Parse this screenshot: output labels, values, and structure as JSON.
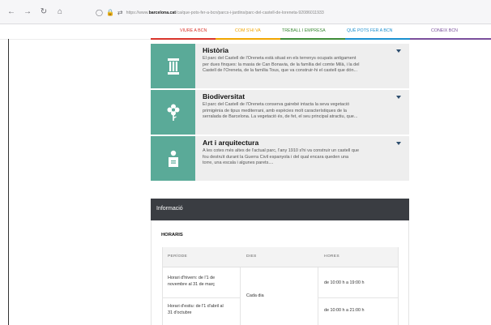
{
  "browser": {
    "url_prefix": "https://www.",
    "url_domain": "barcelona.cat",
    "url_path": "/ca/que-pots-fer-a-bcn/parcs-i-jardins/parc-del-castell-de-loreneta-92086011933"
  },
  "site_nav": {
    "items": [
      {
        "label": "VIURE A BCN",
        "color": "#d9342b"
      },
      {
        "label": "COM S'HI VA",
        "color": "#f0a500"
      },
      {
        "label": "TREBALL I EMPRESA",
        "color": "#3d8b37"
      },
      {
        "label": "QUÈ POTS FER A BCN",
        "color": "#1a8fcf"
      },
      {
        "label": "CONEIX BCN",
        "color": "#7a4f9c"
      }
    ]
  },
  "cards": [
    {
      "icon": "column-icon",
      "title": "Història",
      "lines": [
        "El parc del Castell de l'Oreneta està situat en els terrenys ocupats antigament",
        "per dues finques: la masia de Can Bonavia, de la família del comte Milà, i la del",
        "Castell de l'Oreneta, de la família Tous, que va construir-hi el castell que dón..."
      ]
    },
    {
      "icon": "flower-icon",
      "title": "Biodiversitat",
      "lines": [
        "El parc del Castell de l'Oreneta conserva gairebé intacta la seva vegetació",
        "primigènia de tipus mediterrani, amb espècies molt característiques de la",
        "serralada de Barcelona. La vegetació és, de fet, el seu principal atractiu, que..."
      ]
    },
    {
      "icon": "person-icon",
      "title": "Art i arquitectura",
      "lines": [
        "A les cotes més altes de l'actual parc, l'any 1910 s'hi va construir un castell que",
        "fou destruït durant la Guerra Civil espanyola i del qual encara queden una",
        "torre, una escala i algunes parets...."
      ]
    }
  ],
  "info": {
    "header": "Informació",
    "horaris_title": "HORARIS",
    "table": {
      "headers": [
        "PERÍODE",
        "DIES",
        "HORES"
      ],
      "rows": [
        {
          "periode": [
            "Horari d'hivern: de l'1 de",
            "novembre al 31 de març"
          ],
          "hores": "de 10:00 h a 19:00 h"
        },
        {
          "periode": [
            "Horari d'estiu: de l'1 d'abril al",
            "31 d'octubre"
          ],
          "hores": "de 10:00 h a 21:00 h"
        }
      ],
      "dies": "Cada dia"
    }
  },
  "colors": {
    "tile": "#5aaa98",
    "info_header": "#3a3d42",
    "caret": "#2d4e6e"
  }
}
